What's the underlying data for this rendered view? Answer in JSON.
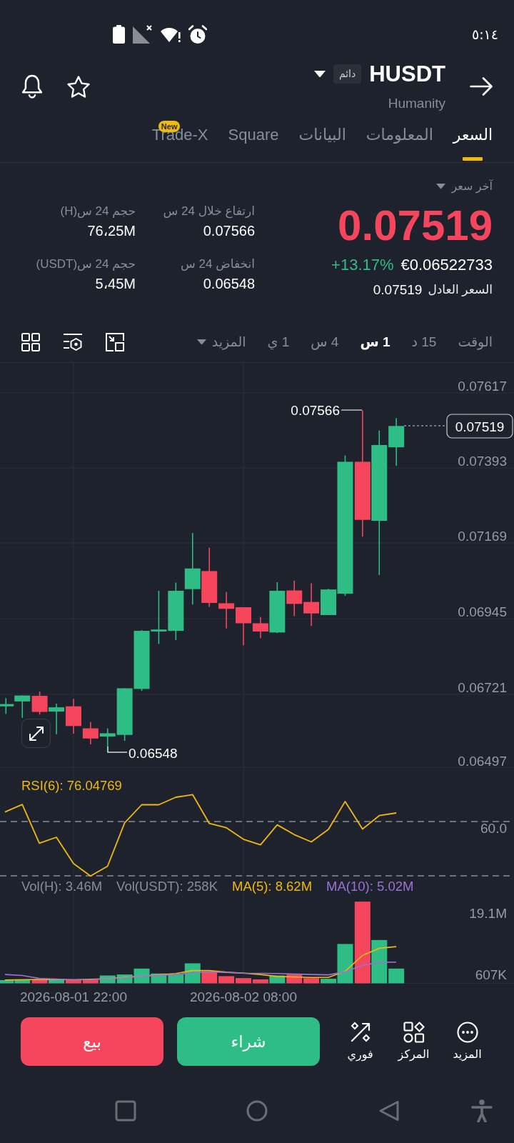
{
  "status_bar": {
    "time": "٥:١٤"
  },
  "header": {
    "symbol": "HUSDT",
    "badge": "دائم",
    "name": "Humanity"
  },
  "tabs": [
    {
      "label": "السعر",
      "selected": true
    },
    {
      "label": "المعلومات",
      "selected": false
    },
    {
      "label": "البيانات",
      "selected": false
    },
    {
      "label": "Square",
      "selected": false
    },
    {
      "label": "Trade-X",
      "selected": false,
      "badge": "New"
    }
  ],
  "price": {
    "label": "آخر سعر",
    "last": "0.07519",
    "falling": true,
    "fiat": "€0.06522733",
    "change": "+13.17%",
    "fair_label": "السعر العادل",
    "fair": "0.07519"
  },
  "stats": [
    {
      "label": "ارتفاع خلال 24 س",
      "value": "0.07566"
    },
    {
      "label": "حجم 24 س(H)",
      "value": "76،25M"
    },
    {
      "label": "انخفاض 24 س",
      "value": "0.06548"
    },
    {
      "label": "حجم 24 س(USDT)",
      "value": "5،45M"
    }
  ],
  "intervals": {
    "options": [
      {
        "label": "الوقت",
        "selected": false
      },
      {
        "label": "15 د",
        "selected": false
      },
      {
        "label": "1 س",
        "selected": true
      },
      {
        "label": "4 س",
        "selected": false
      },
      {
        "label": "1 ي",
        "selected": false
      }
    ],
    "more": "المزيد"
  },
  "chart": {
    "y_labels": [
      "0.07617",
      "0.07393",
      "0.07169",
      "0.06945",
      "0.06721",
      "0.06497"
    ],
    "high_label": "0.07566",
    "low_label": "0.06548",
    "current_price": "0.07519"
  },
  "rsi": {
    "legend": "RSI(6): 76.04769",
    "level_label": "60.0"
  },
  "volume": {
    "legends": [
      {
        "text": "MA(10): 5.02M",
        "color": "#9b72d6"
      },
      {
        "text": "MA(5): 8.62M",
        "color": "#f0b90b"
      },
      {
        "text": "Vol(USDT): 258K",
        "color": "#848e9c"
      },
      {
        "text": "Vol(H): 3.46M",
        "color": "#848e9c"
      }
    ],
    "y_labels": [
      "19.1M",
      "607K"
    ]
  },
  "time_axis": [
    "2026-08-02 08:00",
    "2026-08-01 22:00"
  ],
  "actions": {
    "shortcuts": [
      {
        "label": "المزيد",
        "kind": "more"
      },
      {
        "label": "المركز",
        "kind": "position"
      },
      {
        "label": "فوري",
        "kind": "instant"
      }
    ],
    "buy": "شراء",
    "sell": "بيع"
  }
}
